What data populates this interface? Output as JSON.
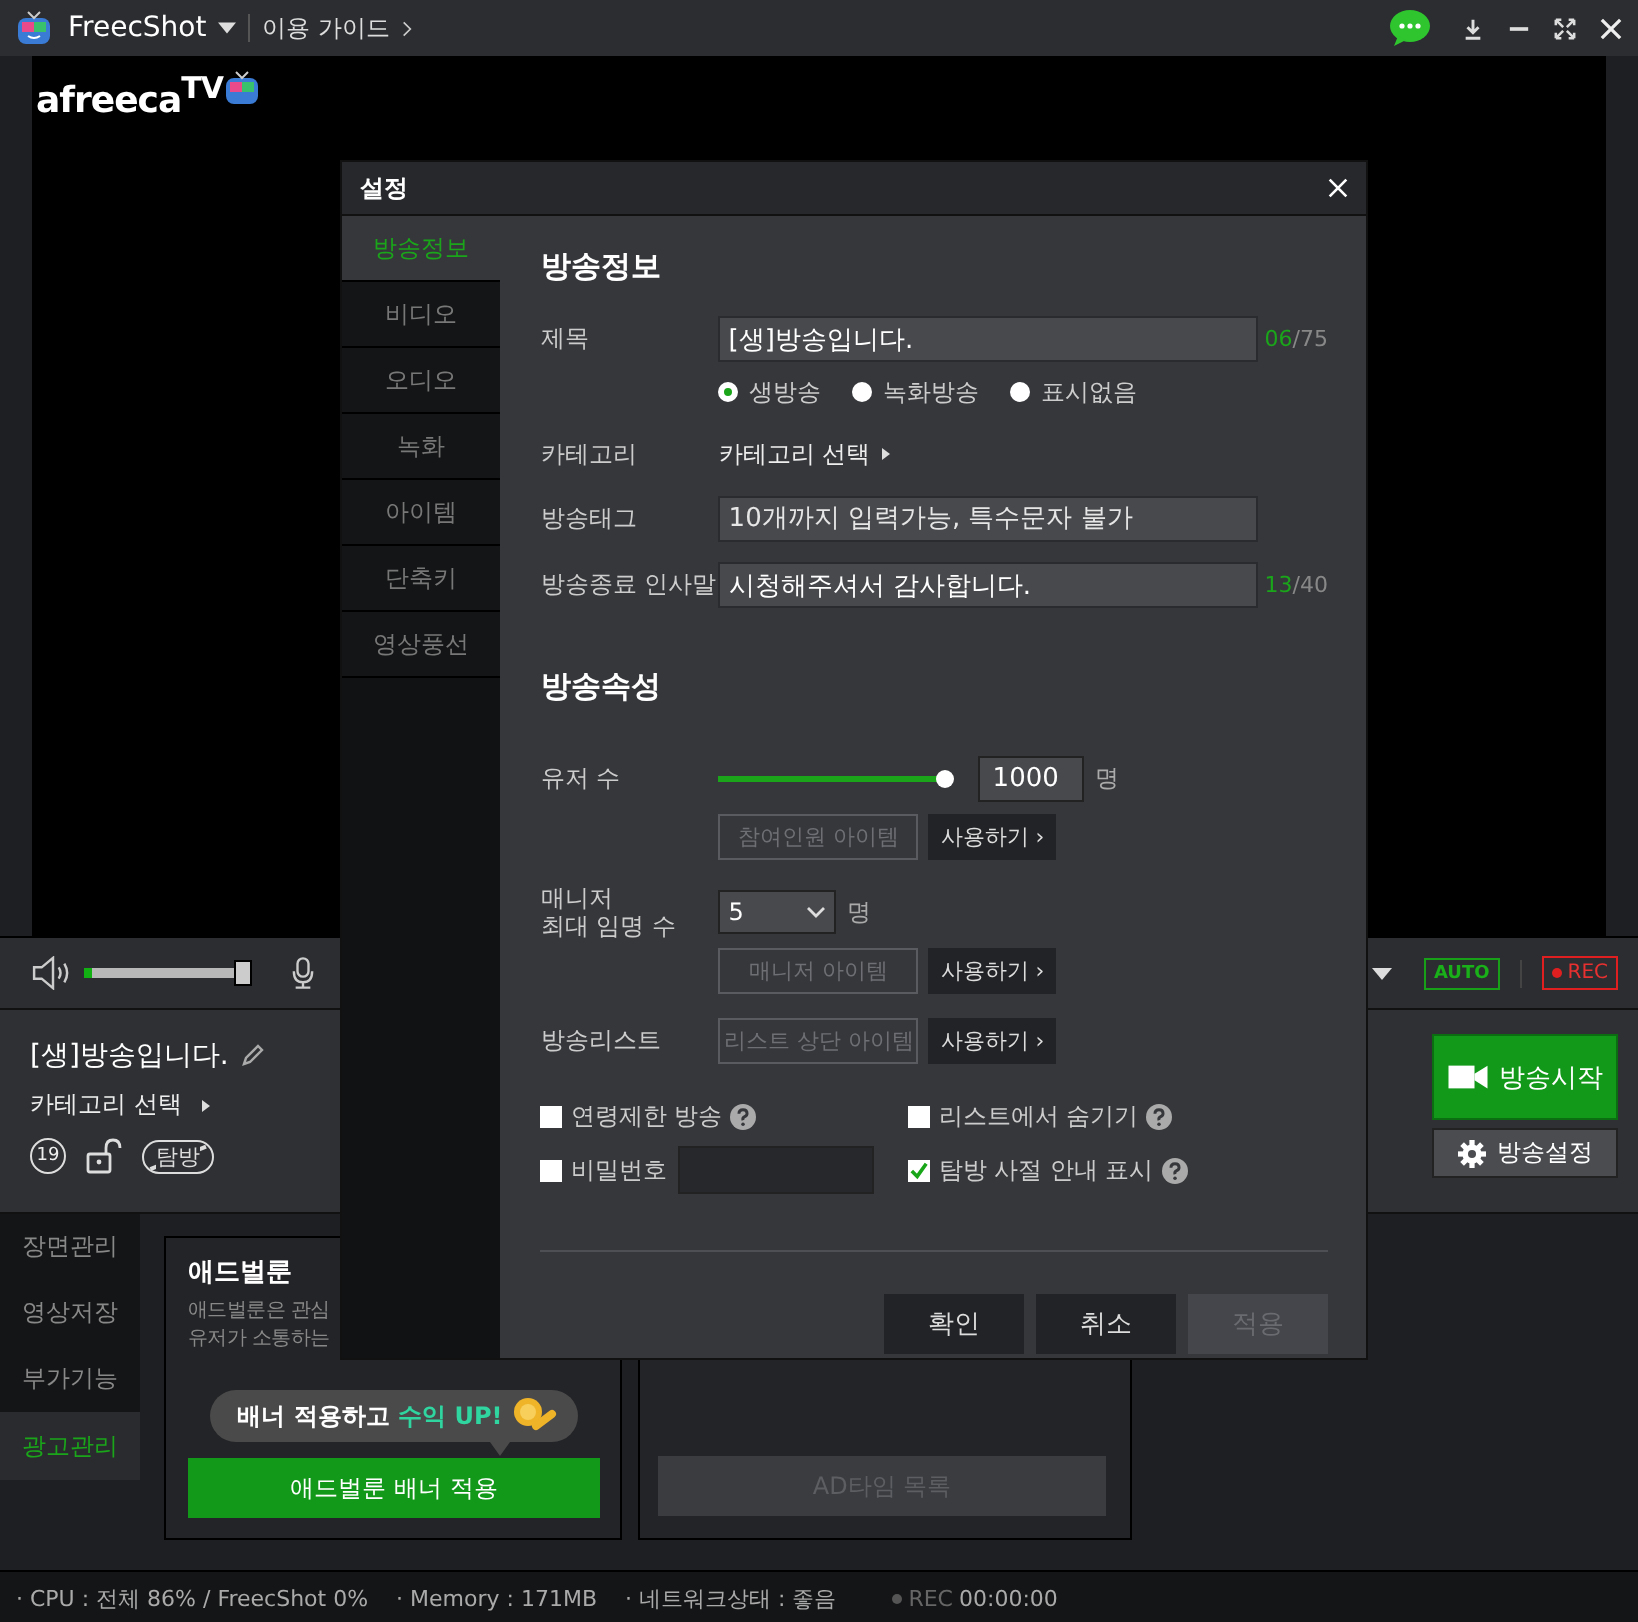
{
  "titlebar": {
    "app": "FreecShot",
    "guide": "이용 가이드"
  },
  "logo": "afreeca$^{TV}$",
  "controls": {
    "volume": {
      "level": 1
    },
    "auto": "AUTO",
    "rec": "REC"
  },
  "broadcast": {
    "title": "[생]방송입니다.",
    "category": "카테고리 선택",
    "age": "19",
    "visit": "탐방",
    "start": "방송시작",
    "settings": "방송설정"
  },
  "nav": [
    {
      "label": "장면관리",
      "selected": false
    },
    {
      "label": "영상저장",
      "selected": false
    },
    {
      "label": "부가기능",
      "selected": false
    },
    {
      "label": "광고관리",
      "selected": true
    }
  ],
  "adballoon": {
    "title": "애드벌룬",
    "desc": "애드벌룬은 관심\n유저가 소통하는",
    "tip": "배너 적용하고",
    "tip_highlight": "수익 UP!",
    "button": "애드벌룬 배너 적용"
  },
  "adtime": {
    "button": "AD타임 목록",
    "disabled": true
  },
  "status_bar": {
    "items": [
      "· CPU : 전체 86% / FreecShot 0%",
      "· Memory : 171MB",
      "· 네트워크상태 : 좋음"
    ],
    "rec": "REC",
    "time": "00:00:00"
  },
  "dialog": {
    "title": "설정",
    "tabs": [
      {
        "label": "방송정보",
        "selected": true
      },
      {
        "label": "비디오",
        "selected": false
      },
      {
        "label": "오디오",
        "selected": false
      },
      {
        "label": "녹화",
        "selected": false
      },
      {
        "label": "아이템",
        "selected": false
      },
      {
        "label": "단축키",
        "selected": false
      },
      {
        "label": "영상풍선",
        "selected": false
      }
    ],
    "info": {
      "heading": "방송정보",
      "title_label": "제목",
      "title_value": "[생]방송입니다.",
      "title_count": "06",
      "title_max": "/75",
      "radios": [
        {
          "label": "생방송",
          "selected": true
        },
        {
          "label": "녹화방송",
          "selected": false
        },
        {
          "label": "표시없음",
          "selected": false
        }
      ],
      "category_label": "카테고리",
      "category_value": "카테고리 선택",
      "tag_label": "방송태그",
      "tag_placeholder": "10개까지 입력가능, 특수문자 불가",
      "bye_label": "방송종료 인사말",
      "bye_value": "시청해주셔서 감사합니다.",
      "bye_count": "13",
      "bye_max": "/40"
    },
    "attrs": {
      "heading": "방송속성",
      "users_label": "유저 수",
      "users_slider": {
        "level": 1
      },
      "users_value": "1000",
      "unit": "명",
      "users_item": "참여인원 아이템",
      "use": "사용하기 ›",
      "manager_label": "매니저\n최대 임명 수",
      "manager_value": "5",
      "manager_unit": "명",
      "manager_item": "매니저 아이템",
      "manager_use": "사용하기 ›",
      "list_label": "방송리스트",
      "list_item": "리스트 상단 아이템",
      "list_use": "사용하기 ›"
    },
    "checks": [
      {
        "label": "연령제한 방송",
        "checked": false,
        "kind": "help"
      },
      {
        "label": "리스트에서 숨기기",
        "checked": false,
        "kind": "help"
      },
      {
        "label": "비밀번호",
        "checked": false,
        "kind": "password"
      },
      {
        "label": "탐방 사절 안내 표시",
        "checked": true,
        "kind": "help"
      }
    ],
    "buttons": [
      {
        "label": "확인",
        "disabled": false
      },
      {
        "label": "취소",
        "disabled": false
      },
      {
        "label": "적용",
        "disabled": true
      }
    ]
  }
}
